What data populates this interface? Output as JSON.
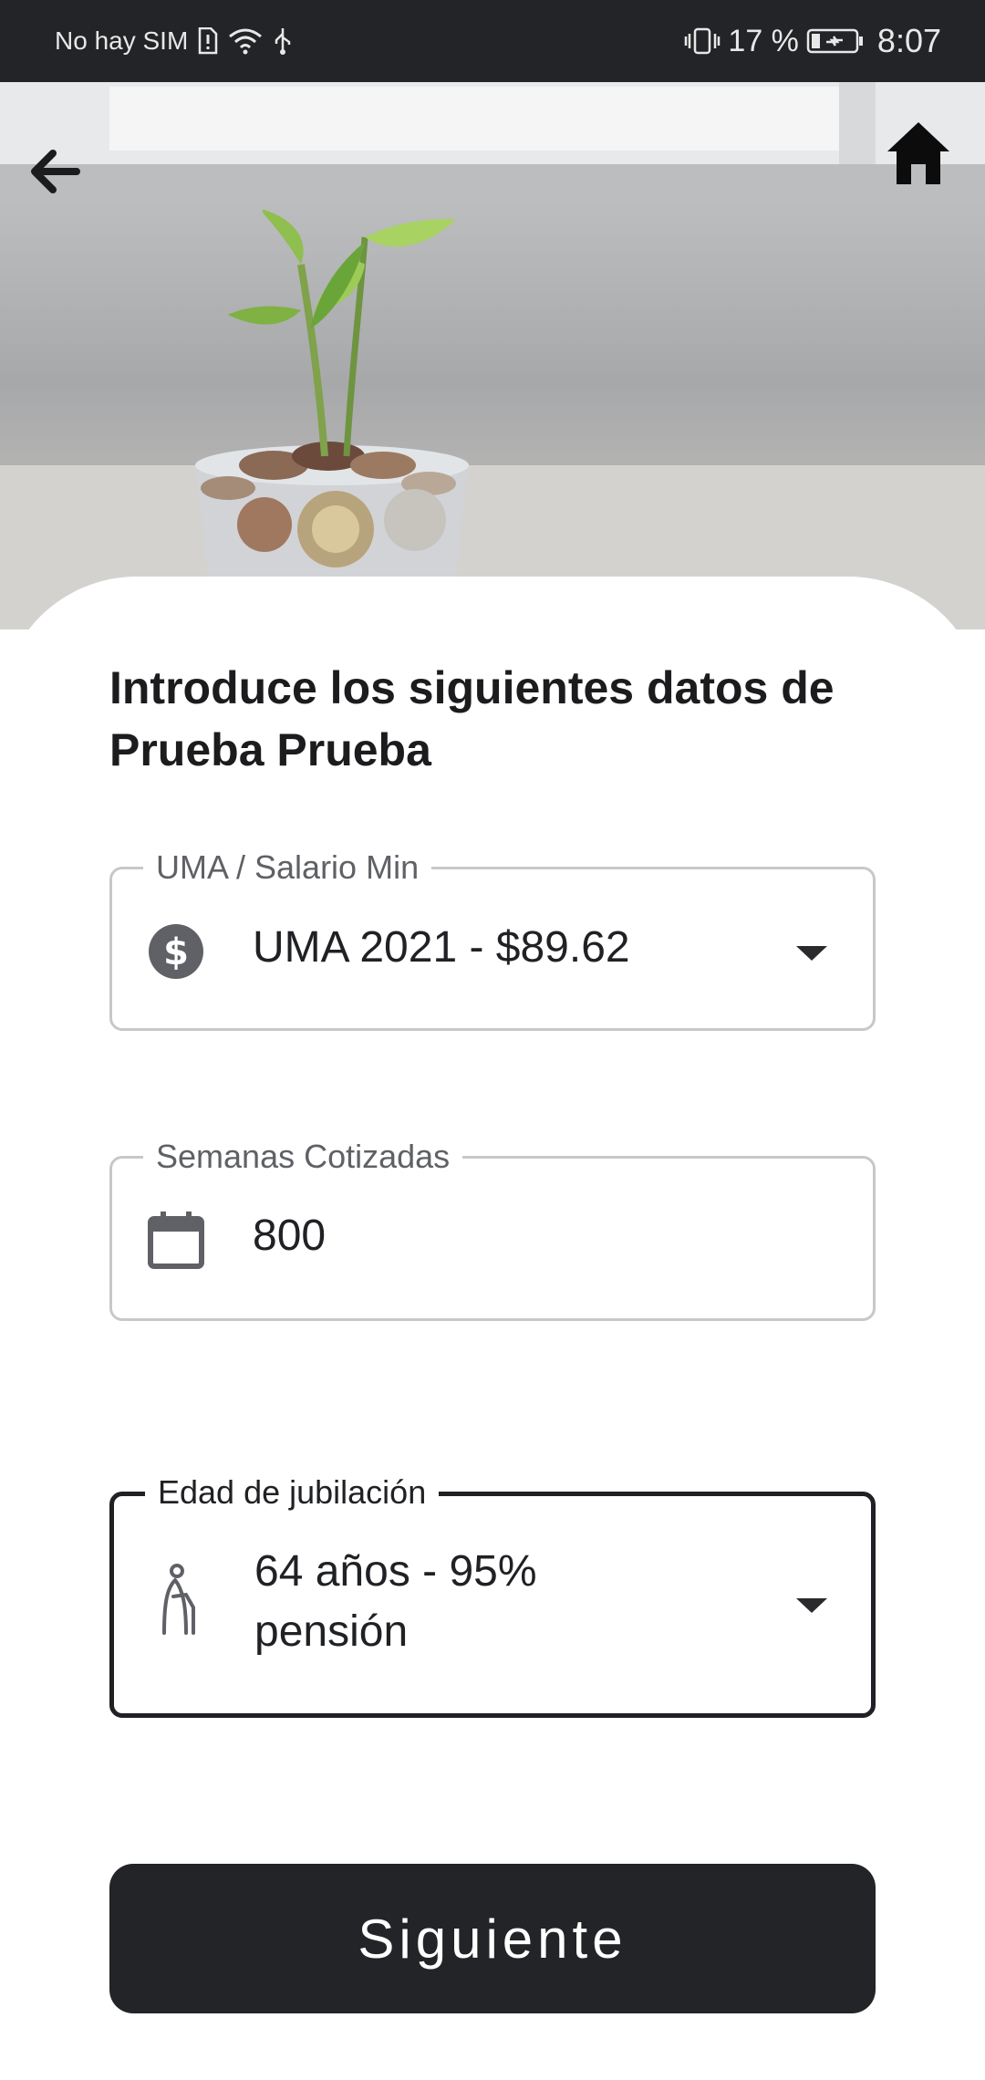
{
  "status_bar": {
    "carrier": "No hay SIM",
    "battery": "17 %",
    "time": "8:07"
  },
  "header": {
    "back_icon": "arrow-left-icon",
    "home_icon": "home-icon"
  },
  "form": {
    "title": "Introduce los siguientes datos de Prueba Prueba",
    "uma": {
      "label": "UMA / Salario Min",
      "value": "UMA 2021 - $89.62",
      "icon": "dollar-circle-icon"
    },
    "weeks": {
      "label": "Semanas Cotizadas",
      "value": "800",
      "icon": "calendar-icon"
    },
    "retirement_age": {
      "label": "Edad de jubilación",
      "value_line1": "64 años - 95%",
      "value_line2": "pensión",
      "icon": "elderly-person-icon"
    }
  },
  "actions": {
    "next_label": "Siguiente"
  },
  "colors": {
    "dark": "#232427",
    "border": "#c8c8ca",
    "label": "#5f6166"
  }
}
